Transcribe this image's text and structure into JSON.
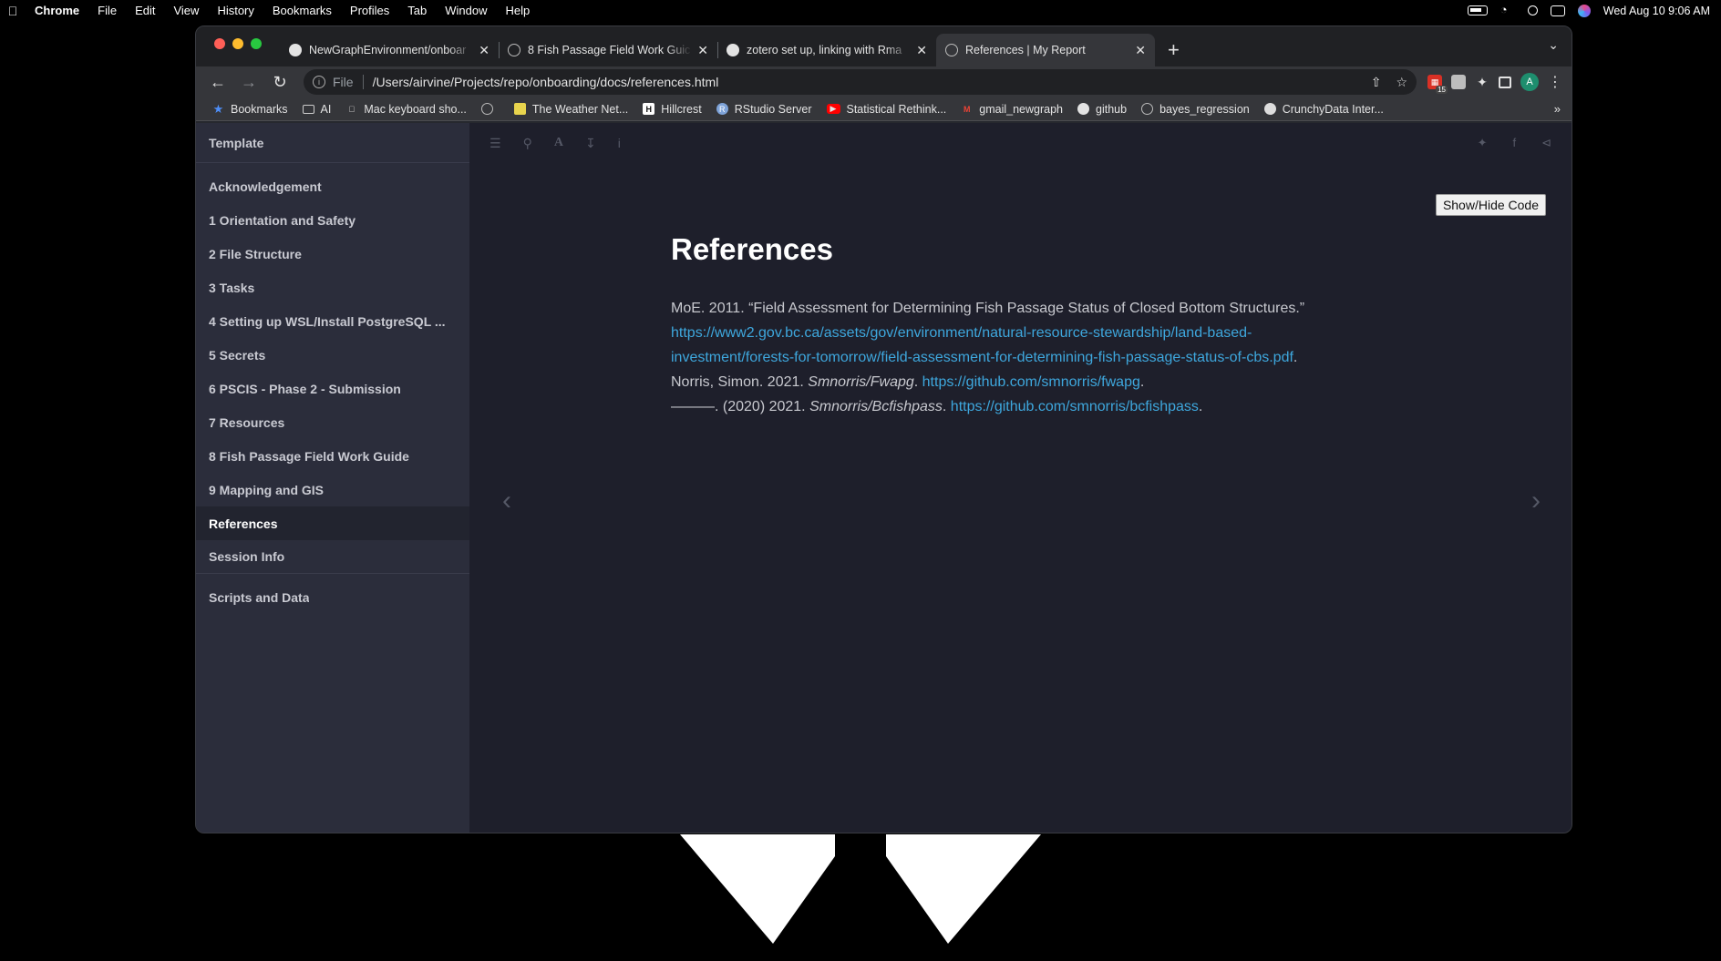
{
  "menubar": {
    "app": "Chrome",
    "items": [
      "File",
      "Edit",
      "View",
      "History",
      "Bookmarks",
      "Profiles",
      "Tab",
      "Window",
      "Help"
    ],
    "clock": "Wed Aug 10  9:06 AM"
  },
  "tabs": [
    {
      "title": "NewGraphEnvironment/onboar",
      "icon": "github-icon"
    },
    {
      "title": "8 Fish Passage Field Work Guic",
      "icon": "globe-icon"
    },
    {
      "title": "zotero set up, linking with Rma",
      "icon": "github-icon"
    },
    {
      "title": "References | My Report",
      "icon": "globe-icon",
      "active": true
    }
  ],
  "toolbar": {
    "scheme": "File",
    "url": "/Users/airvine/Projects/repo/onboarding/docs/references.html",
    "ext_badge": "15",
    "avatar": "A"
  },
  "bookmarks": [
    {
      "label": "Bookmarks",
      "icon": "star-icon"
    },
    {
      "label": "AI",
      "icon": "folder-icon"
    },
    {
      "label": "Mac keyboard sho...",
      "icon": "apple-icon"
    },
    {
      "label": "",
      "icon": "globe-icon"
    },
    {
      "label": "The Weather Net...",
      "icon": "weather-icon"
    },
    {
      "label": "Hillcrest",
      "icon": "h-icon"
    },
    {
      "label": "RStudio Server",
      "icon": "r-icon"
    },
    {
      "label": "Statistical Rethink...",
      "icon": "youtube-icon"
    },
    {
      "label": "gmail_newgraph",
      "icon": "gmail-icon"
    },
    {
      "label": "github",
      "icon": "github-icon"
    },
    {
      "label": "bayes_regression",
      "icon": "globe-icon"
    },
    {
      "label": "CrunchyData Inter...",
      "icon": "crunchydata-icon"
    }
  ],
  "sidebar": {
    "template": "Template",
    "items": [
      "Acknowledgement",
      "1 Orientation and Safety",
      "2 File Structure",
      "3 Tasks",
      "4 Setting up WSL/Install PostgreSQL ...",
      "5 Secrets",
      "6 PSCIS - Phase 2 - Submission",
      "7 Resources",
      "8 Fish Passage Field Work Guide",
      "9 Mapping and GIS",
      "References",
      "Session Info"
    ],
    "active_index": 10,
    "footer": "Scripts and Data"
  },
  "main": {
    "showhide_label": "Show/Hide Code",
    "title": "References",
    "ref1": {
      "text": "MoE. 2011. “Field Assessment for Determining Fish Passage Status of Closed Bottom Structures.” ",
      "link_line1": "https://www2.gov.bc.ca/assets/gov/environment/natural-resource-stewardship/land-based-",
      "link_line2": "investment/forests-for-tomorrow/field-assessment-for-determining-fish-passage-status-of-cbs.pdf",
      "end": "."
    },
    "ref2": {
      "text": "Norris, Simon. 2021. ",
      "title": "Smnorris/Fwapg",
      "sep": ". ",
      "link": "https://github.com/smnorris/fwapg",
      "end": "."
    },
    "ref3": {
      "text": "———. (2020) 2021. ",
      "title": "Smnorris/Bcfishpass",
      "sep": ". ",
      "link": "https://github.com/smnorris/bcfishpass",
      "end": "."
    }
  },
  "colors": {
    "sidebar_bg": "#2b2d3b",
    "main_bg": "#1e1f2b",
    "link": "#3ea7dd"
  }
}
